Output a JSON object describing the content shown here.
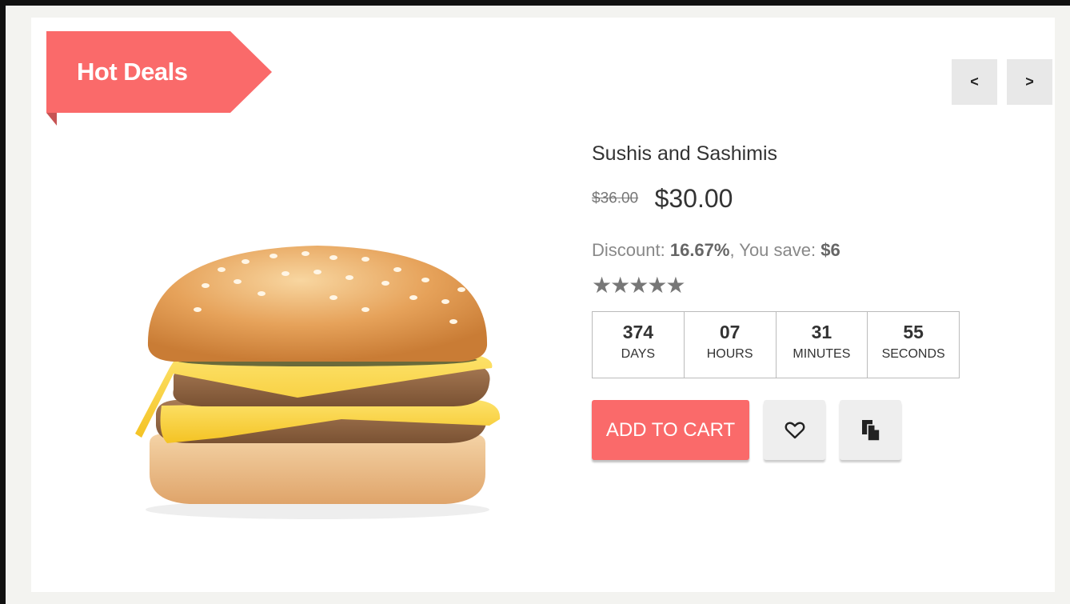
{
  "deal": {
    "ribbon_label": "Hot Deals",
    "nav": {
      "prev_label": "<",
      "next_label": ">"
    }
  },
  "product": {
    "name": "Sushis and Sashimis",
    "old_price": "$36.00",
    "new_price": "$30.00",
    "discount_label": "Discount:",
    "discount_value": "16.67%",
    "save_label": ", You save:",
    "save_value": "$6",
    "rating": 5,
    "rating_max": 5,
    "stars_text": "★★★★★",
    "image": "burger-image"
  },
  "countdown": [
    {
      "value": "374",
      "label": "DAYS"
    },
    {
      "value": "07",
      "label": "HOURS"
    },
    {
      "value": "31",
      "label": "MINUTES"
    },
    {
      "value": "55",
      "label": "SECONDS"
    }
  ],
  "actions": {
    "add_to_cart_label": "ADD TO CART",
    "wishlist_icon": "heart-icon",
    "compare_icon": "copy-icon"
  },
  "colors": {
    "accent": "#fa6a6a",
    "button_grey": "#eeeeee"
  }
}
